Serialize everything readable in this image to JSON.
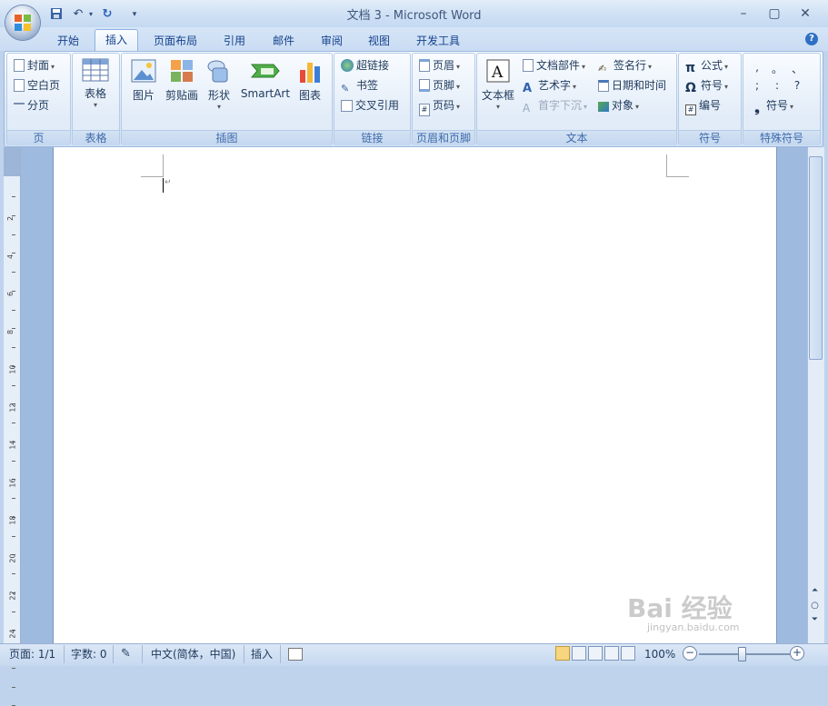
{
  "window": {
    "title": "文档 3 - Microsoft Word",
    "controls": [
      "–",
      "▢",
      "✕"
    ]
  },
  "tabs": [
    {
      "label": "开始"
    },
    {
      "label": "插入",
      "active": true
    },
    {
      "label": "页面布局"
    },
    {
      "label": "引用"
    },
    {
      "label": "邮件"
    },
    {
      "label": "审阅"
    },
    {
      "label": "视图"
    },
    {
      "label": "开发工具"
    }
  ],
  "ribbon": {
    "page": {
      "label": "页",
      "items": [
        "封面",
        "空白页",
        "分页"
      ]
    },
    "table": {
      "label": "表格",
      "button": "表格"
    },
    "illustrations": {
      "label": "插图",
      "buttons": [
        "图片",
        "剪贴画",
        "形状",
        "SmartArt",
        "图表"
      ]
    },
    "links": {
      "label": "链接",
      "items": [
        "超链接",
        "书签",
        "交叉引用"
      ]
    },
    "header_footer": {
      "label": "页眉和页脚",
      "items": [
        "页眉",
        "页脚",
        "页码"
      ]
    },
    "text": {
      "label": "文本",
      "textbox": "文本框",
      "items": [
        "文档部件",
        "艺术字",
        "首字下沉",
        "签名行",
        "日期和时间",
        "对象"
      ]
    },
    "symbols": {
      "label": "符号",
      "items": [
        "公式",
        "符号",
        "编号"
      ]
    },
    "special": {
      "label": "特殊符号",
      "chars": [
        ",",
        "。",
        "、",
        ";",
        ":",
        "?"
      ],
      "button": "符号"
    }
  },
  "ruler": {
    "numbers": [
      "2",
      "4",
      "6",
      "8",
      "10",
      "12",
      "14",
      "16",
      "18",
      "20",
      "22",
      "24"
    ]
  },
  "status": {
    "page": "页面: 1/1",
    "words": "字数: 0",
    "language": "中文(简体，中国)",
    "mode": "插入",
    "zoom": "100%",
    "zoom_level": 1.0
  },
  "watermark": {
    "text": "Bai 经验",
    "sub": "jingyan.baidu.com"
  }
}
